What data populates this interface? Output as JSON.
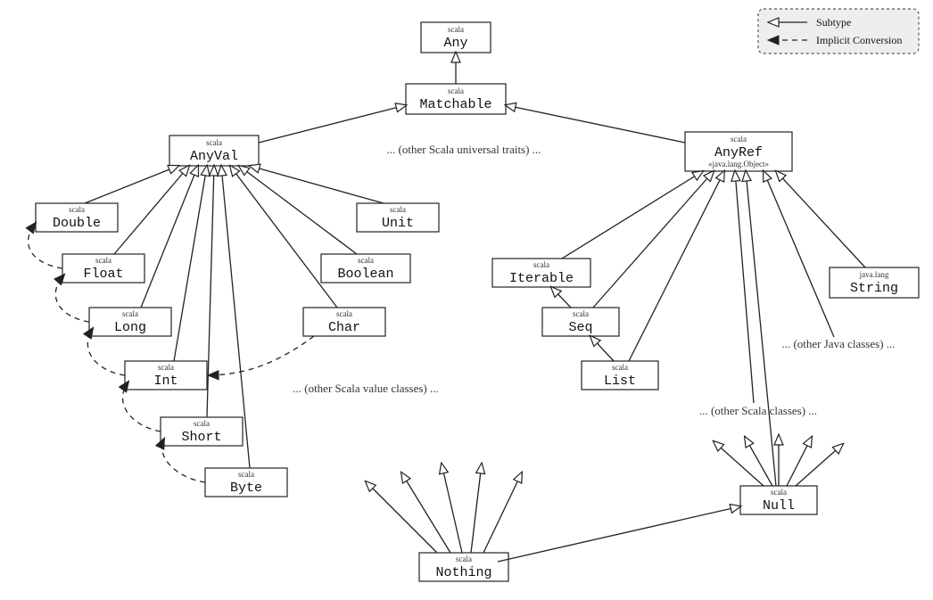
{
  "legend": {
    "subtype": "Subtype",
    "implicit": "Implicit Conversion"
  },
  "notes": {
    "universal_traits": "... (other Scala universal traits) ...",
    "value_classes": "... (other Scala value classes) ...",
    "java_classes": "... (other Java classes) ...",
    "scala_classes": "... (other Scala classes) ...",
    "anyref_stereo": "«java.lang.Object»"
  },
  "nodes": {
    "any": {
      "pkg": "scala",
      "name": "Any"
    },
    "matchable": {
      "pkg": "scala",
      "name": "Matchable"
    },
    "anyval": {
      "pkg": "scala",
      "name": "AnyVal"
    },
    "anyref": {
      "pkg": "scala",
      "name": "AnyRef"
    },
    "double": {
      "pkg": "scala",
      "name": "Double"
    },
    "float": {
      "pkg": "scala",
      "name": "Float"
    },
    "long": {
      "pkg": "scala",
      "name": "Long"
    },
    "int": {
      "pkg": "scala",
      "name": "Int"
    },
    "short": {
      "pkg": "scala",
      "name": "Short"
    },
    "byte": {
      "pkg": "scala",
      "name": "Byte"
    },
    "char": {
      "pkg": "scala",
      "name": "Char"
    },
    "boolean": {
      "pkg": "scala",
      "name": "Boolean"
    },
    "unit": {
      "pkg": "scala",
      "name": "Unit"
    },
    "iterable": {
      "pkg": "scala",
      "name": "Iterable"
    },
    "seq": {
      "pkg": "scala",
      "name": "Seq"
    },
    "list": {
      "pkg": "scala",
      "name": "List"
    },
    "string": {
      "pkg": "java.lang",
      "name": "String"
    },
    "null": {
      "pkg": "scala",
      "name": "Null"
    },
    "nothing": {
      "pkg": "scala",
      "name": "Nothing"
    }
  }
}
